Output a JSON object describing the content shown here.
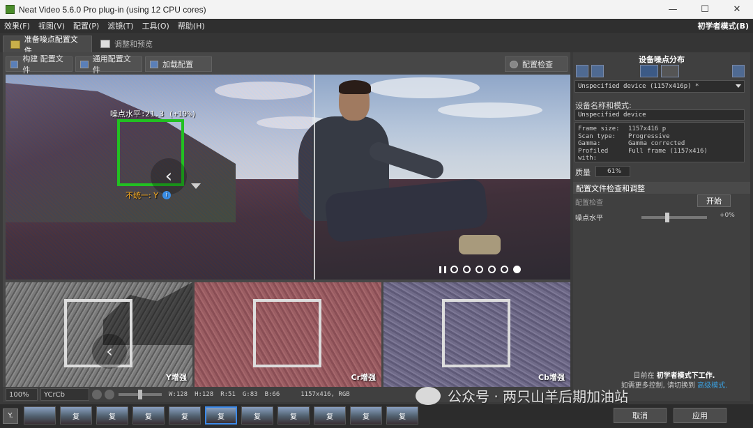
{
  "window": {
    "title": "Neat Video 5.6.0 Pro plug-in (using 12 CPU cores)",
    "minimize": "—",
    "maximize": "☐",
    "close": "✕"
  },
  "menu": {
    "items": [
      "效果(F)",
      "视图(V)",
      "配置(P)",
      "滤镜(T)",
      "工具(O)",
      "帮助(H)"
    ],
    "mode": "初学者模式(B)"
  },
  "tabs": [
    {
      "label": "准备噪点配置文件"
    },
    {
      "label": "调整和预览"
    }
  ],
  "toolbar": {
    "build_profile": "构建 配置文件",
    "generic_profile": "通用配置文件",
    "load_profile": "加载配置",
    "profile_check": "配置检查"
  },
  "viewer": {
    "noise_level": "噪点水平:21.3 (+19%)",
    "uniform": "不统一: Y",
    "info_icon": "i",
    "arrow": "‹"
  },
  "panels": [
    {
      "label": "Y增强",
      "arrow": "‹"
    },
    {
      "label": "Cr增强"
    },
    {
      "label": "Cb增强"
    }
  ],
  "statusbar": {
    "zoom": "100%",
    "colorspace": "YCrCb",
    "w": "W:128",
    "h": "H:128",
    "r": "R:51",
    "g": "G:83",
    "b": "B:66",
    "extra": "1157x416, RGB"
  },
  "filmstrip": {
    "first": "Y.",
    "thumb_label": "复"
  },
  "buttons": {
    "cancel": "取消",
    "apply": "应用"
  },
  "right_panel": {
    "title": "设备噪点分布",
    "device_select": "Unspecified device (1157x416p) *",
    "device_name_label": "设备名称和模式:",
    "device_name": "Unspecified device",
    "info": [
      {
        "k": "Frame size:",
        "v": "1157x416 p"
      },
      {
        "k": "Scan type:",
        "v": "Progressive"
      },
      {
        "k": "Gamma:",
        "v": "Gamma corrected"
      },
      {
        "k": "Profiled with:",
        "v": "Full frame (1157x416)"
      }
    ],
    "quality_label": "质量",
    "quality_value": "61%",
    "section": "配置文件检查和调整",
    "profile_check_label": "配置检查",
    "start": "开始",
    "noise_level_label": "噪点水平",
    "noise_level_value": "+0%",
    "note_prefix": "目前在",
    "note_mode": "初学者模式下工作.",
    "note_line2": "如需更多控制, 请切换到",
    "note_link": "高级模式."
  },
  "watermark": "公众号 · 两只山羊后期加油站"
}
